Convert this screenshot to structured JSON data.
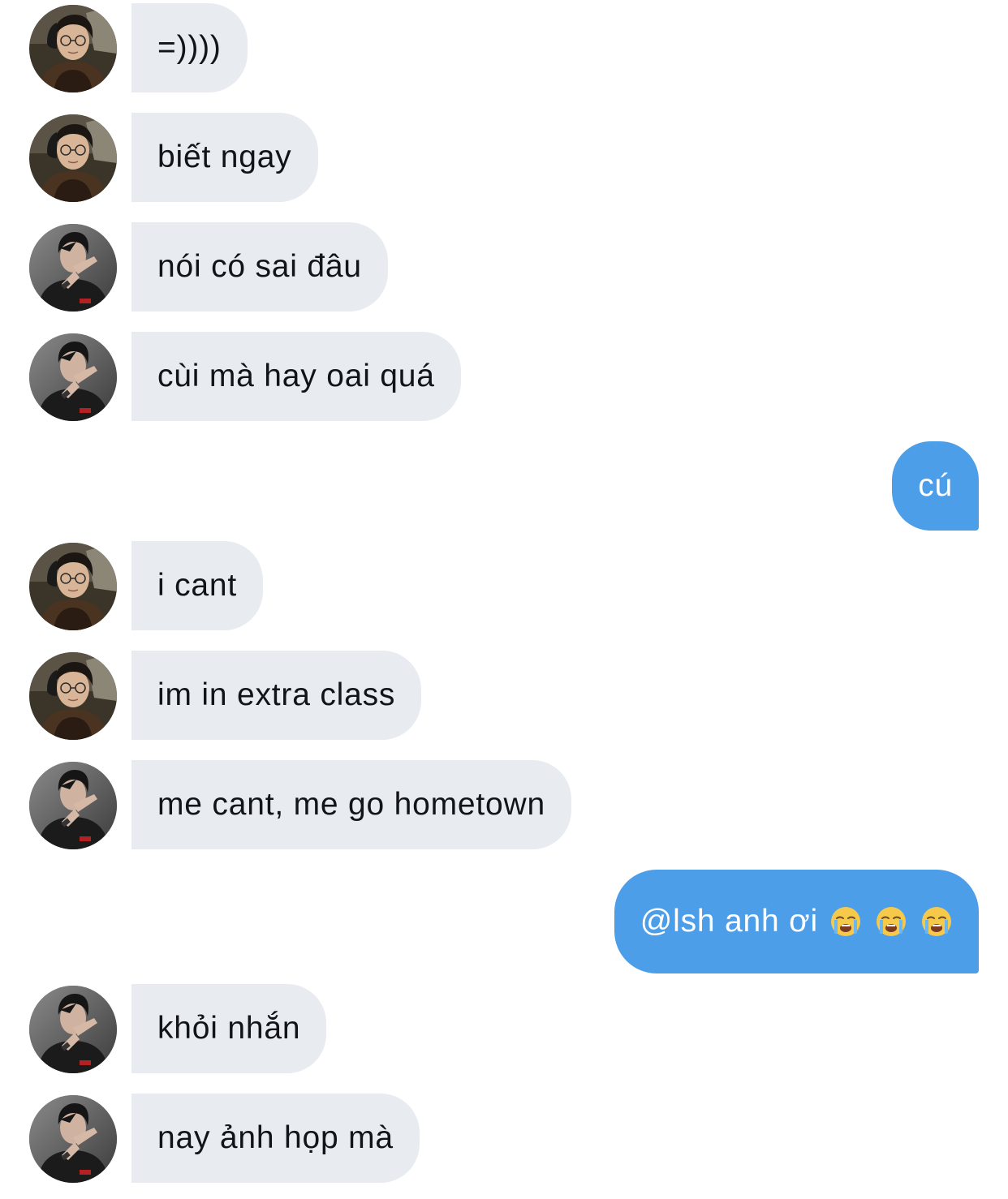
{
  "conversation": {
    "messages": [
      {
        "text": "=))))",
        "side": "in",
        "avatar": "glasses-boy-avatar"
      },
      {
        "text": "biết ngay",
        "side": "in",
        "avatar": "glasses-boy-avatar"
      },
      {
        "text": "nói có sai đâu",
        "side": "in",
        "avatar": "posing-boy-avatar"
      },
      {
        "text": "cùi mà hay oai quá",
        "side": "in",
        "avatar": "posing-boy-avatar"
      },
      {
        "text": "cú",
        "side": "out"
      },
      {
        "text": "i cant",
        "side": "in",
        "avatar": "glasses-boy-avatar"
      },
      {
        "text": "im in extra class",
        "side": "in",
        "avatar": "glasses-boy-avatar"
      },
      {
        "text": "me cant, me go hometown",
        "side": "in",
        "avatar": "posing-boy-avatar"
      },
      {
        "text": "@lsh anh ơi",
        "side": "out",
        "emoji": "loudly-crying-face-icon",
        "emoji_count": 3
      },
      {
        "text": "khỏi nhắn",
        "side": "in",
        "avatar": "posing-boy-avatar"
      },
      {
        "text": "nay ảnh họp mà",
        "side": "in",
        "avatar": "posing-boy-avatar"
      }
    ]
  },
  "colors": {
    "incoming_bubble": "#e8ebef",
    "outgoing_bubble": "#4c9ee8",
    "incoming_text": "#111418",
    "outgoing_text": "#ffffff"
  }
}
